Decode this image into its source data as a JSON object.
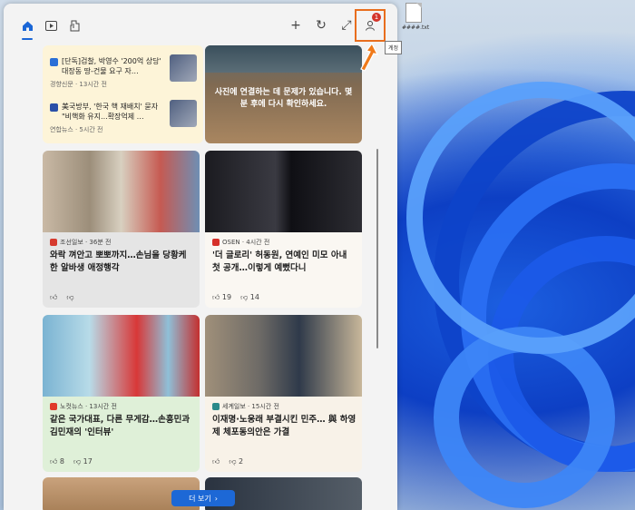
{
  "desktop": {
    "file_label": "####.txt"
  },
  "toolbar": {
    "home_icon": "home-icon",
    "video_icon": "video-icon",
    "sports_icon": "sports-icon",
    "add_icon": "+",
    "refresh_icon": "↻",
    "expand_icon": "⤢",
    "profile_badge": "1",
    "tooltip": "계정"
  },
  "news_card": {
    "items": [
      {
        "title": "[단독]검찰, 박영수 '200억 상당' 대장동 땅-건물 요구 자…",
        "source": "경향신문 · 13시간 전"
      },
      {
        "title": "美국방부, '한국 핵 재배치' 묻자 \"비핵화 유지...확장억제 …",
        "source": "연합뉴스 · 5시간 전"
      }
    ]
  },
  "error_card": {
    "message": "사진에 연결하는 데 문제가 있습니다. 몇 분 후에 다시 확인하세요."
  },
  "cards": [
    {
      "source": "조선일보 · 36분 전",
      "title": "와락 껴안고 뽀뽀까지…손님을 당황케 한 알바생 애정행각",
      "likes": "",
      "dislikes": ""
    },
    {
      "source": "OSEN · 4시간 전",
      "title": "'더 글로리' 허동원, 연예인 미모 아내 첫 공개…이렇게 예뻤다니",
      "likes": "19",
      "dislikes": "14"
    },
    {
      "source": "노컷뉴스 · 13시간 전",
      "title": "같은 국가대표, 다른 무게감…손흥민과 김민재의 '인터뷰'",
      "likes": "8",
      "dislikes": "17"
    },
    {
      "source": "세계일보 · 15시간 전",
      "title": "이재명·노웅래 부결시킨 민주… 與 하영제 체포동의안은 가결",
      "likes": "",
      "dislikes": "2"
    }
  ],
  "more_button": {
    "label": "더 보기",
    "chevron": "›"
  }
}
